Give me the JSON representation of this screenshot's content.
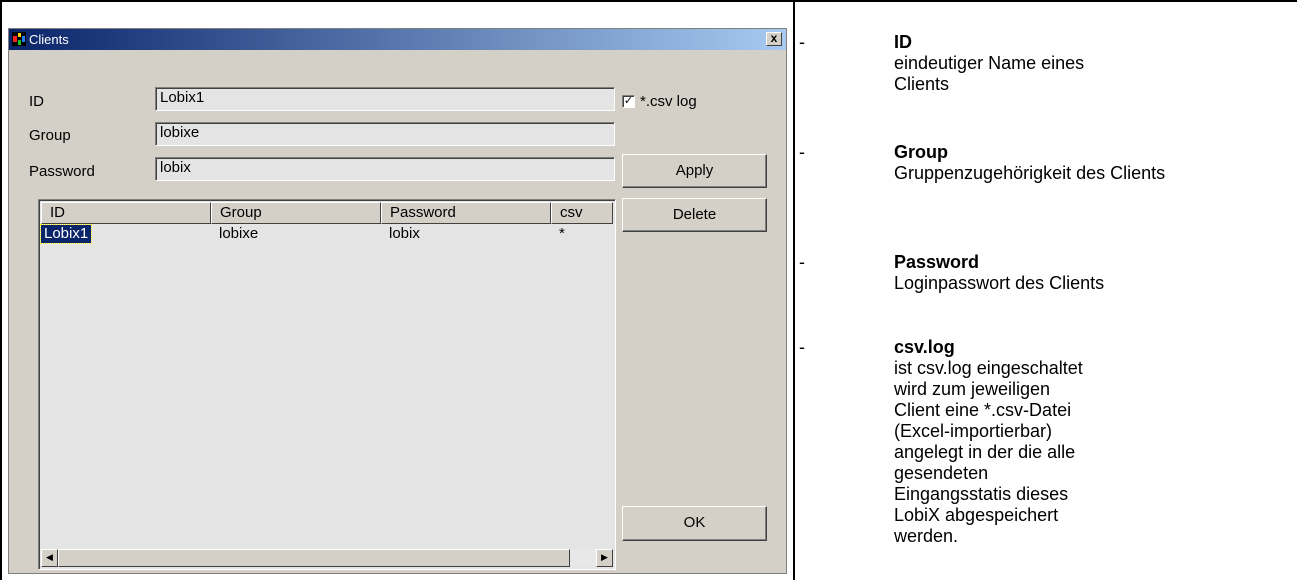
{
  "dialog": {
    "title": "Clients",
    "close_label": "x",
    "labels": {
      "id": "ID",
      "group": "Group",
      "password": "Password"
    },
    "fields": {
      "id": "Lobix1",
      "group": "lobixe",
      "password": "lobix"
    },
    "checkbox": {
      "label": "*.csv log",
      "checked": true,
      "mark": "✓"
    },
    "buttons": {
      "apply": "Apply",
      "delete": "Delete",
      "ok": "OK"
    },
    "list": {
      "columns": [
        "ID",
        "Group",
        "Password",
        "csv"
      ],
      "rows": [
        {
          "id": "Lobix1",
          "group": "lobixe",
          "password": "lobix",
          "csv": "*"
        }
      ]
    },
    "scroll_left_icon": "◀",
    "scroll_right_icon": "▶"
  },
  "doc": [
    {
      "bullet": "-",
      "title": "ID",
      "desc": "eindeutiger Name eines Clients"
    },
    {
      "bullet": "-",
      "title": "Group",
      "desc": "Gruppenzugehörigkeit des Clients"
    },
    {
      "bullet": "-",
      "title": "Password",
      "desc": "Loginpasswort des Clients"
    },
    {
      "bullet": "-",
      "title": "csv.log",
      "desc": "ist csv.log eingeschaltet wird zum jeweiligen Client eine *.csv-Datei (Excel-importierbar) angelegt in der die alle gesendeten Eingangsstatis dieses LobiX abgespeichert werden."
    }
  ]
}
